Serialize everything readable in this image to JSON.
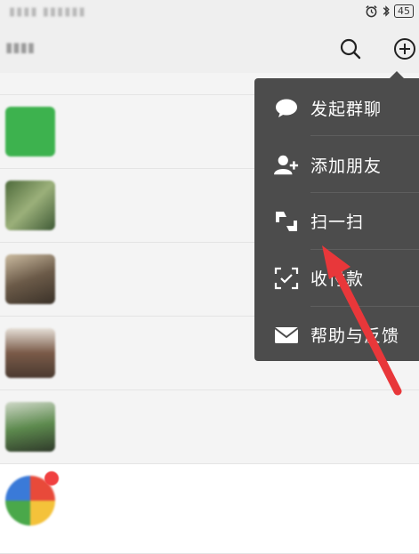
{
  "status_bar": {
    "battery": "45"
  },
  "chats": [
    {
      "name": "",
      "preview": "",
      "time": "",
      "avatar_color": "#bcbcbc"
    },
    {
      "name": "",
      "preview": "",
      "time": "",
      "avatar_color": "#3db24e"
    },
    {
      "name": "",
      "preview": "",
      "time": "",
      "avatar_color": "#6f8a55"
    },
    {
      "name": "",
      "preview": "",
      "time": "",
      "avatar_color": "#8a7a64"
    },
    {
      "name": "",
      "preview": "",
      "time": "",
      "avatar_color": "#7d6a5c"
    },
    {
      "name": "",
      "preview": "",
      "time": "",
      "avatar_color": "#6f8f6a"
    },
    {
      "name": "",
      "preview": "",
      "time": "",
      "avatar_color": "#5ba04a"
    }
  ],
  "popup_menu": {
    "items": [
      {
        "label": "发起群聊",
        "icon": "chat-bubble-icon"
      },
      {
        "label": "添加朋友",
        "icon": "add-friend-icon"
      },
      {
        "label": "扫一扫",
        "icon": "scan-icon"
      },
      {
        "label": "收付款",
        "icon": "payment-icon"
      },
      {
        "label": "帮助与反馈",
        "icon": "mail-icon"
      }
    ]
  },
  "colors": {
    "popup_bg": "#4c4c4c",
    "arrow": "#e8373a",
    "badge": "#f04040"
  }
}
